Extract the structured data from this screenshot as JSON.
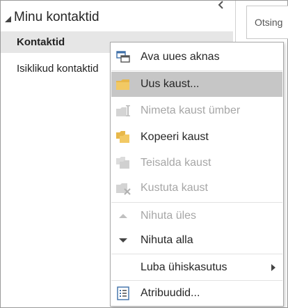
{
  "pane": {
    "group_label": "Minu kontaktid",
    "folders": [
      "Kontaktid",
      "Isiklikud kontaktid"
    ]
  },
  "search": {
    "label": "Otsing"
  },
  "menu": {
    "items": [
      {
        "label": "Ava uues aknas",
        "icon": "new-window-icon",
        "disabled": false
      },
      {
        "label": "Uus kaust...",
        "icon": "new-folder-icon",
        "disabled": false
      },
      {
        "label": "Nimeta kaust ümber",
        "icon": "rename-folder-icon",
        "disabled": true
      },
      {
        "label": "Kopeeri kaust",
        "icon": "copy-folder-icon",
        "disabled": false
      },
      {
        "label": "Teisalda kaust",
        "icon": "move-folder-icon",
        "disabled": true
      },
      {
        "label": "Kustuta kaust",
        "icon": "delete-folder-icon",
        "disabled": true
      },
      {
        "label": "Nihuta üles",
        "icon": "arrow-up-icon",
        "disabled": true
      },
      {
        "label": "Nihuta alla",
        "icon": "arrow-down-icon",
        "disabled": false
      },
      {
        "label": "Luba ühiskasutus",
        "icon": "",
        "disabled": false,
        "submenu": true
      },
      {
        "label": "Atribuudid...",
        "icon": "properties-icon",
        "disabled": false
      }
    ]
  },
  "colors": {
    "folder": "#e8b84a",
    "highlight": "#c6c6c6",
    "selected": "#e6e6e6",
    "disabled": "#a6a6a6"
  }
}
